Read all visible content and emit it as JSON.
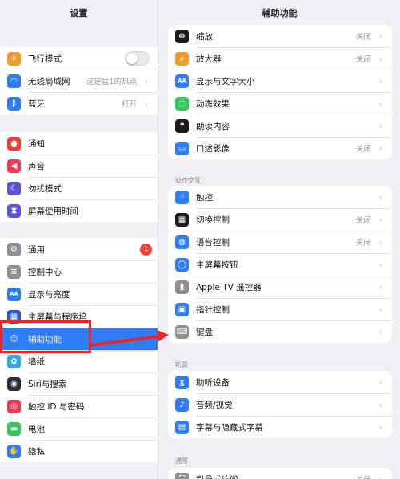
{
  "left": {
    "title": "设置",
    "groups": [
      [
        {
          "label": "飞行模式",
          "icon": "airplane-icon",
          "color": "#f79a2c",
          "control": "toggle"
        },
        {
          "label": "无线局域网",
          "value": "这是猛1的热点",
          "icon": "wifi-icon",
          "color": "#2e7cf6"
        },
        {
          "label": "蓝牙",
          "value": "打开",
          "icon": "bluetooth-icon",
          "color": "#2e7cf6"
        }
      ],
      [
        {
          "label": "通知",
          "icon": "notification-icon",
          "color": "#f03b34"
        },
        {
          "label": "声音",
          "icon": "speaker-icon",
          "color": "#f03b55"
        },
        {
          "label": "勿扰模式",
          "icon": "moon-icon",
          "color": "#5856d6"
        },
        {
          "label": "屏幕使用时间",
          "icon": "hourglass-icon",
          "color": "#5856d6"
        }
      ],
      [
        {
          "label": "通用",
          "badge": "1",
          "icon": "gear-icon",
          "color": "#8e8e93"
        },
        {
          "label": "控制中心",
          "icon": "switches-icon",
          "color": "#8e8e93"
        },
        {
          "label": "显示与亮度",
          "icon": "aa-icon",
          "color": "#2e7cf6"
        },
        {
          "label": "主屏幕与程序坞",
          "icon": "grid-icon",
          "color": "#2e56c8"
        },
        {
          "label": "辅助功能",
          "icon": "accessibility-icon",
          "color": "#2e7cf6",
          "selected": true
        },
        {
          "label": "墙纸",
          "icon": "flower-icon",
          "color": "#34aadc"
        },
        {
          "label": "Siri与搜索",
          "icon": "siri-icon",
          "color": "#2b2b3a"
        },
        {
          "label": "触控 ID 与密码",
          "icon": "fingerprint-icon",
          "color": "#f03b55"
        },
        {
          "label": "电池",
          "icon": "battery-icon",
          "color": "#34c759"
        },
        {
          "label": "隐私",
          "icon": "hand-icon",
          "color": "#2e7cf6"
        }
      ]
    ]
  },
  "right": {
    "title": "辅助功能",
    "groups": [
      {
        "header": "",
        "items": [
          {
            "label": "缩放",
            "value": "关闭",
            "icon": "zoom-icon",
            "color": "#1c1c1e"
          },
          {
            "label": "放大器",
            "value": "关闭",
            "icon": "magnifier-icon",
            "color": "#f79a2c"
          },
          {
            "label": "显示与文字大小",
            "icon": "aa-icon",
            "color": "#2e7cf6"
          },
          {
            "label": "动态效果",
            "icon": "motion-icon",
            "color": "#34c759"
          },
          {
            "label": "朗读内容",
            "icon": "speech-icon",
            "color": "#1c1c1e"
          },
          {
            "label": "口述影像",
            "value": "关闭",
            "icon": "audio-description-icon",
            "color": "#2e7cf6"
          }
        ]
      },
      {
        "header": "动作交互",
        "items": [
          {
            "label": "触控",
            "icon": "touch-icon",
            "color": "#2e7cf6"
          },
          {
            "label": "切换控制",
            "value": "关闭",
            "icon": "switch-control-icon",
            "color": "#1c1c1e"
          },
          {
            "label": "语音控制",
            "value": "关闭",
            "icon": "voice-control-icon",
            "color": "#2e7cf6"
          },
          {
            "label": "主屏幕按钮",
            "icon": "home-button-icon",
            "color": "#2e7cf6"
          },
          {
            "label": "Apple TV 遥控器",
            "icon": "remote-icon",
            "color": "#8e8e93"
          },
          {
            "label": "指针控制",
            "icon": "pointer-icon",
            "color": "#2e7cf6"
          },
          {
            "label": "键盘",
            "icon": "keyboard-icon",
            "color": "#8e8e93"
          }
        ]
      },
      {
        "header": "听觉",
        "items": [
          {
            "label": "助听设备",
            "icon": "ear-icon",
            "color": "#2e7cf6"
          },
          {
            "label": "音频/视觉",
            "icon": "audio-visual-icon",
            "color": "#2e7cf6"
          },
          {
            "label": "字幕与隐藏式字幕",
            "icon": "captions-icon",
            "color": "#2e7cf6"
          }
        ]
      },
      {
        "header": "通用",
        "items": [
          {
            "label": "引导式访问",
            "value": "关闭",
            "icon": "lock-icon",
            "color": "#8e8e93"
          }
        ]
      }
    ]
  },
  "glyphs": {
    "airplane-icon": "✈",
    "wifi-icon": "◠",
    "bluetooth-icon": "ᛒ",
    "notification-icon": "●",
    "speaker-icon": "◀",
    "moon-icon": "☾",
    "hourglass-icon": "⧗",
    "gear-icon": "⚙",
    "switches-icon": "≡",
    "aa-icon": "AA",
    "grid-icon": "▦",
    "accessibility-icon": "☺",
    "flower-icon": "✿",
    "siri-icon": "◉",
    "fingerprint-icon": "◎",
    "battery-icon": "▬",
    "hand-icon": "✋",
    "zoom-icon": "⊕",
    "magnifier-icon": "⌕",
    "motion-icon": "◌",
    "speech-icon": "❝",
    "audio-description-icon": "▭",
    "touch-icon": "☝",
    "switch-control-icon": "▦",
    "voice-control-icon": "◍",
    "home-button-icon": "◯",
    "remote-icon": "▮",
    "pointer-icon": "▣",
    "keyboard-icon": "⌨",
    "ear-icon": "ʒ",
    "audio-visual-icon": "♪",
    "captions-icon": "▤",
    "lock-icon": "⛶"
  },
  "chevron": "›",
  "annotation": {
    "box_color": "#e82626",
    "arrow_color": "#e82626"
  }
}
